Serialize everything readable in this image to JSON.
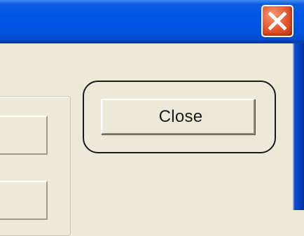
{
  "window": {
    "title_close_icon": "close-x-icon"
  },
  "dialog": {
    "close_button_label": "Close"
  },
  "colors": {
    "titlebar": "#0055e6",
    "close_icon_bg": "#e4532b",
    "window_bg": "#ece9d8"
  }
}
